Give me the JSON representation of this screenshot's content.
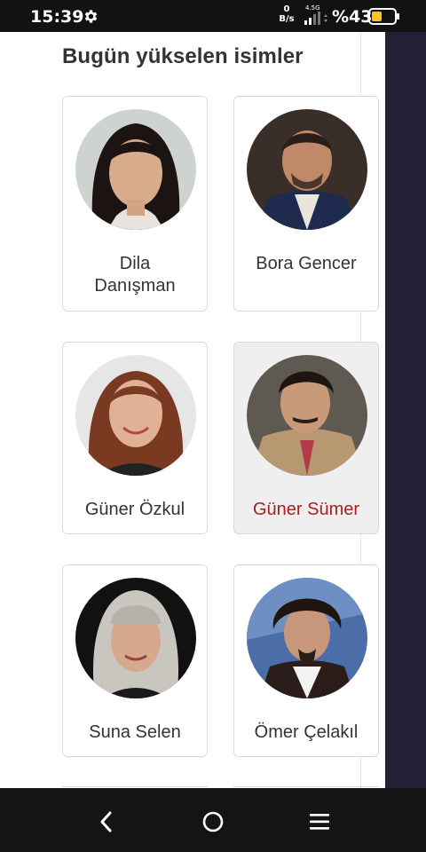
{
  "status_bar": {
    "time": "15:39",
    "net_speed_value": "0",
    "net_speed_unit": "B/s",
    "network_type": "4.5G",
    "battery_percent": "%43",
    "icons": [
      "gear-icon",
      "signal-icon",
      "battery-icon"
    ]
  },
  "section": {
    "title": "Bugün yükselen isimler"
  },
  "people": [
    {
      "name": "Dila Danışman",
      "line1": "Dila",
      "line2": "Danışman"
    },
    {
      "name": "Bora Gencer"
    },
    {
      "name": "Güner Özkul"
    },
    {
      "name": "Güner Sümer",
      "active": true
    },
    {
      "name": "Suna Selen"
    },
    {
      "name": "Ömer Çelakıl"
    }
  ],
  "colors": {
    "active_name": "#a52121",
    "text": "#333333",
    "card_border": "#d9d9d9",
    "active_card_bg": "#efefef",
    "right_strip": "#242036"
  },
  "nav_bar": {
    "icons": [
      "back-icon",
      "home-icon",
      "menu-icon"
    ]
  }
}
